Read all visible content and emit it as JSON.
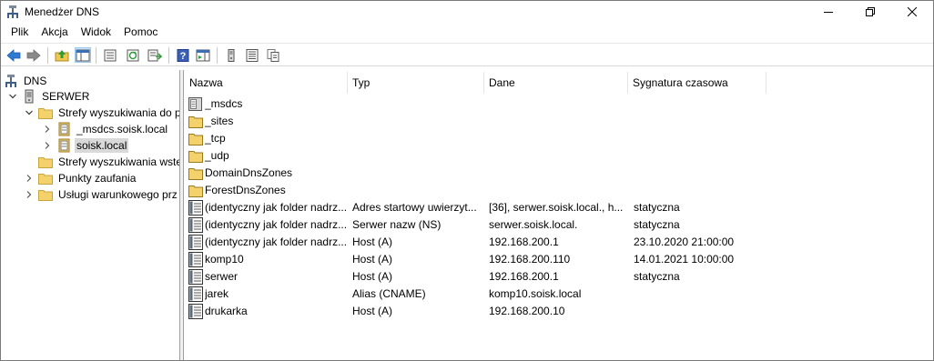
{
  "window": {
    "title": "Menedżer DNS"
  },
  "menu": {
    "items": [
      "Plik",
      "Akcja",
      "Widok",
      "Pomoc"
    ]
  },
  "toolbar": {
    "icons": [
      "back-arrow-icon",
      "forward-arrow-icon",
      "up-folder-icon",
      "show-console-tree-icon",
      "properties-icon",
      "refresh-icon",
      "export-list-icon",
      "help-icon",
      "action-pane-icon",
      "server-icon",
      "zone-list-icon",
      "copy-icon"
    ]
  },
  "tree": {
    "root": "DNS",
    "server": "SERWER",
    "forward_zones": "Strefy wyszukiwania do p",
    "zone_msdcs": "_msdcs.soisk.local",
    "zone_soisk": "soisk.local",
    "reverse_zones": "Strefy wyszukiwania wste",
    "trust_points": "Punkty zaufania",
    "conditional_forwarders": "Usługi warunkowego prz"
  },
  "list": {
    "columns": {
      "name": "Nazwa",
      "type": "Typ",
      "data": "Dane",
      "timestamp": "Sygnatura czasowa"
    },
    "rows": [
      {
        "name": "_msdcs",
        "type": "",
        "data": "",
        "timestamp": "",
        "icon": "delegated-zone-icon"
      },
      {
        "name": "_sites",
        "type": "",
        "data": "",
        "timestamp": "",
        "icon": "folder-icon"
      },
      {
        "name": "_tcp",
        "type": "",
        "data": "",
        "timestamp": "",
        "icon": "folder-icon"
      },
      {
        "name": "_udp",
        "type": "",
        "data": "",
        "timestamp": "",
        "icon": "folder-icon"
      },
      {
        "name": "DomainDnsZones",
        "type": "",
        "data": "",
        "timestamp": "",
        "icon": "folder-icon"
      },
      {
        "name": "ForestDnsZones",
        "type": "",
        "data": "",
        "timestamp": "",
        "icon": "folder-icon"
      },
      {
        "name": "(identyczny jak folder nadrz...",
        "type": "Adres startowy uwierzyt...",
        "data": "[36], serwer.soisk.local., h...",
        "timestamp": "statyczna",
        "icon": "record-icon"
      },
      {
        "name": "(identyczny jak folder nadrz...",
        "type": "Serwer nazw (NS)",
        "data": "serwer.soisk.local.",
        "timestamp": "statyczna",
        "icon": "record-icon"
      },
      {
        "name": "(identyczny jak folder nadrz...",
        "type": "Host (A)",
        "data": "192.168.200.1",
        "timestamp": "23.10.2020 21:00:00",
        "icon": "record-icon"
      },
      {
        "name": "komp10",
        "type": "Host (A)",
        "data": "192.168.200.110",
        "timestamp": "14.01.2021 10:00:00",
        "icon": "record-icon"
      },
      {
        "name": "serwer",
        "type": "Host (A)",
        "data": "192.168.200.1",
        "timestamp": "statyczna",
        "icon": "record-icon"
      },
      {
        "name": "jarek",
        "type": "Alias (CNAME)",
        "data": "komp10.soisk.local",
        "timestamp": "",
        "icon": "record-icon"
      },
      {
        "name": "drukarka",
        "type": "Host (A)",
        "data": "192.168.200.10",
        "timestamp": "",
        "icon": "record-icon"
      }
    ]
  }
}
